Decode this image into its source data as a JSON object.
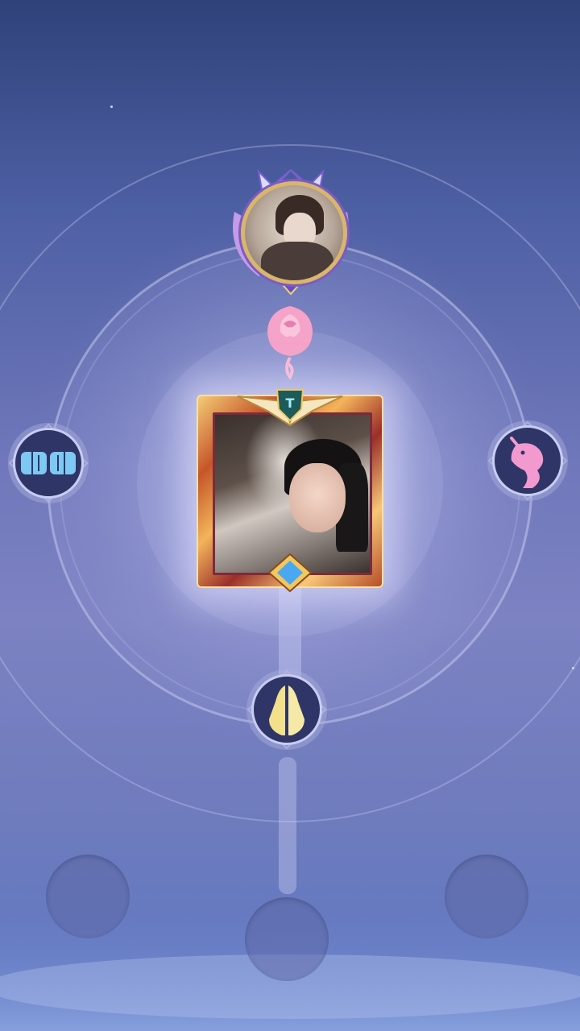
{
  "scene": {
    "name": "intimacy-relationship-wheel",
    "colors": {
      "background_top": "#2f4279",
      "background_mid": "#7078bb",
      "ring_line": "#c9cdf0",
      "node_fill": "#2f3566",
      "frame_gold": "#f3b45a",
      "rose_pink": "#f5a3c8",
      "fist_blue": "#7ec9f3",
      "unicorn_pink": "#f29ad0",
      "hands_yellow": "#f3e08a"
    }
  },
  "top_badge": {
    "icon": "profile-badge-icon"
  },
  "center_avatar": {
    "icon": "profile-avatar-frame-icon"
  },
  "connector": {
    "icon": "rose-icon"
  },
  "relationship_nodes": [
    {
      "id": "left",
      "icon": "fist-bump-icon"
    },
    {
      "id": "right",
      "icon": "unicorn-icon"
    },
    {
      "id": "bottom",
      "icon": "praying-hands-icon"
    }
  ],
  "empty_slots": [
    {
      "id": "slot-left"
    },
    {
      "id": "slot-center"
    },
    {
      "id": "slot-right"
    }
  ]
}
